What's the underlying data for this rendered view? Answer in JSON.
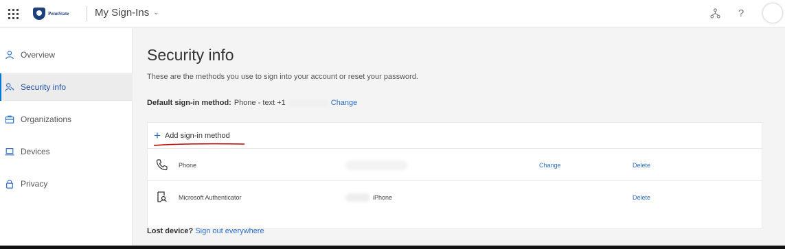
{
  "header": {
    "logo_text": "PennState",
    "app_title": "My Sign-Ins",
    "org_icon": "org-chart-icon",
    "help_label": "?"
  },
  "sidebar": {
    "items": [
      {
        "label": "Overview",
        "icon": "person-icon",
        "active": false
      },
      {
        "label": "Security info",
        "icon": "security-info-icon",
        "active": true
      },
      {
        "label": "Organizations",
        "icon": "briefcase-icon",
        "active": false
      },
      {
        "label": "Devices",
        "icon": "laptop-icon",
        "active": false
      },
      {
        "label": "Privacy",
        "icon": "lock-icon",
        "active": false
      }
    ]
  },
  "main": {
    "title": "Security info",
    "description": "These are the methods you use to sign into your account or reset your password.",
    "default_method": {
      "label": "Default sign-in method:",
      "value": "Phone - text +1",
      "change_link": "Change"
    },
    "add_method_label": "Add sign-in method",
    "methods": [
      {
        "name": "Phone",
        "detail": "",
        "change": "Change",
        "delete": "Delete",
        "icon": "phone-icon"
      },
      {
        "name": "Microsoft Authenticator",
        "detail": "iPhone",
        "change": "",
        "delete": "Delete",
        "icon": "authenticator-icon"
      }
    ],
    "lost_device": {
      "label": "Lost device?",
      "link": "Sign out everywhere"
    }
  },
  "colors": {
    "accent": "#2b6cc4",
    "annotation": "#c00000"
  }
}
